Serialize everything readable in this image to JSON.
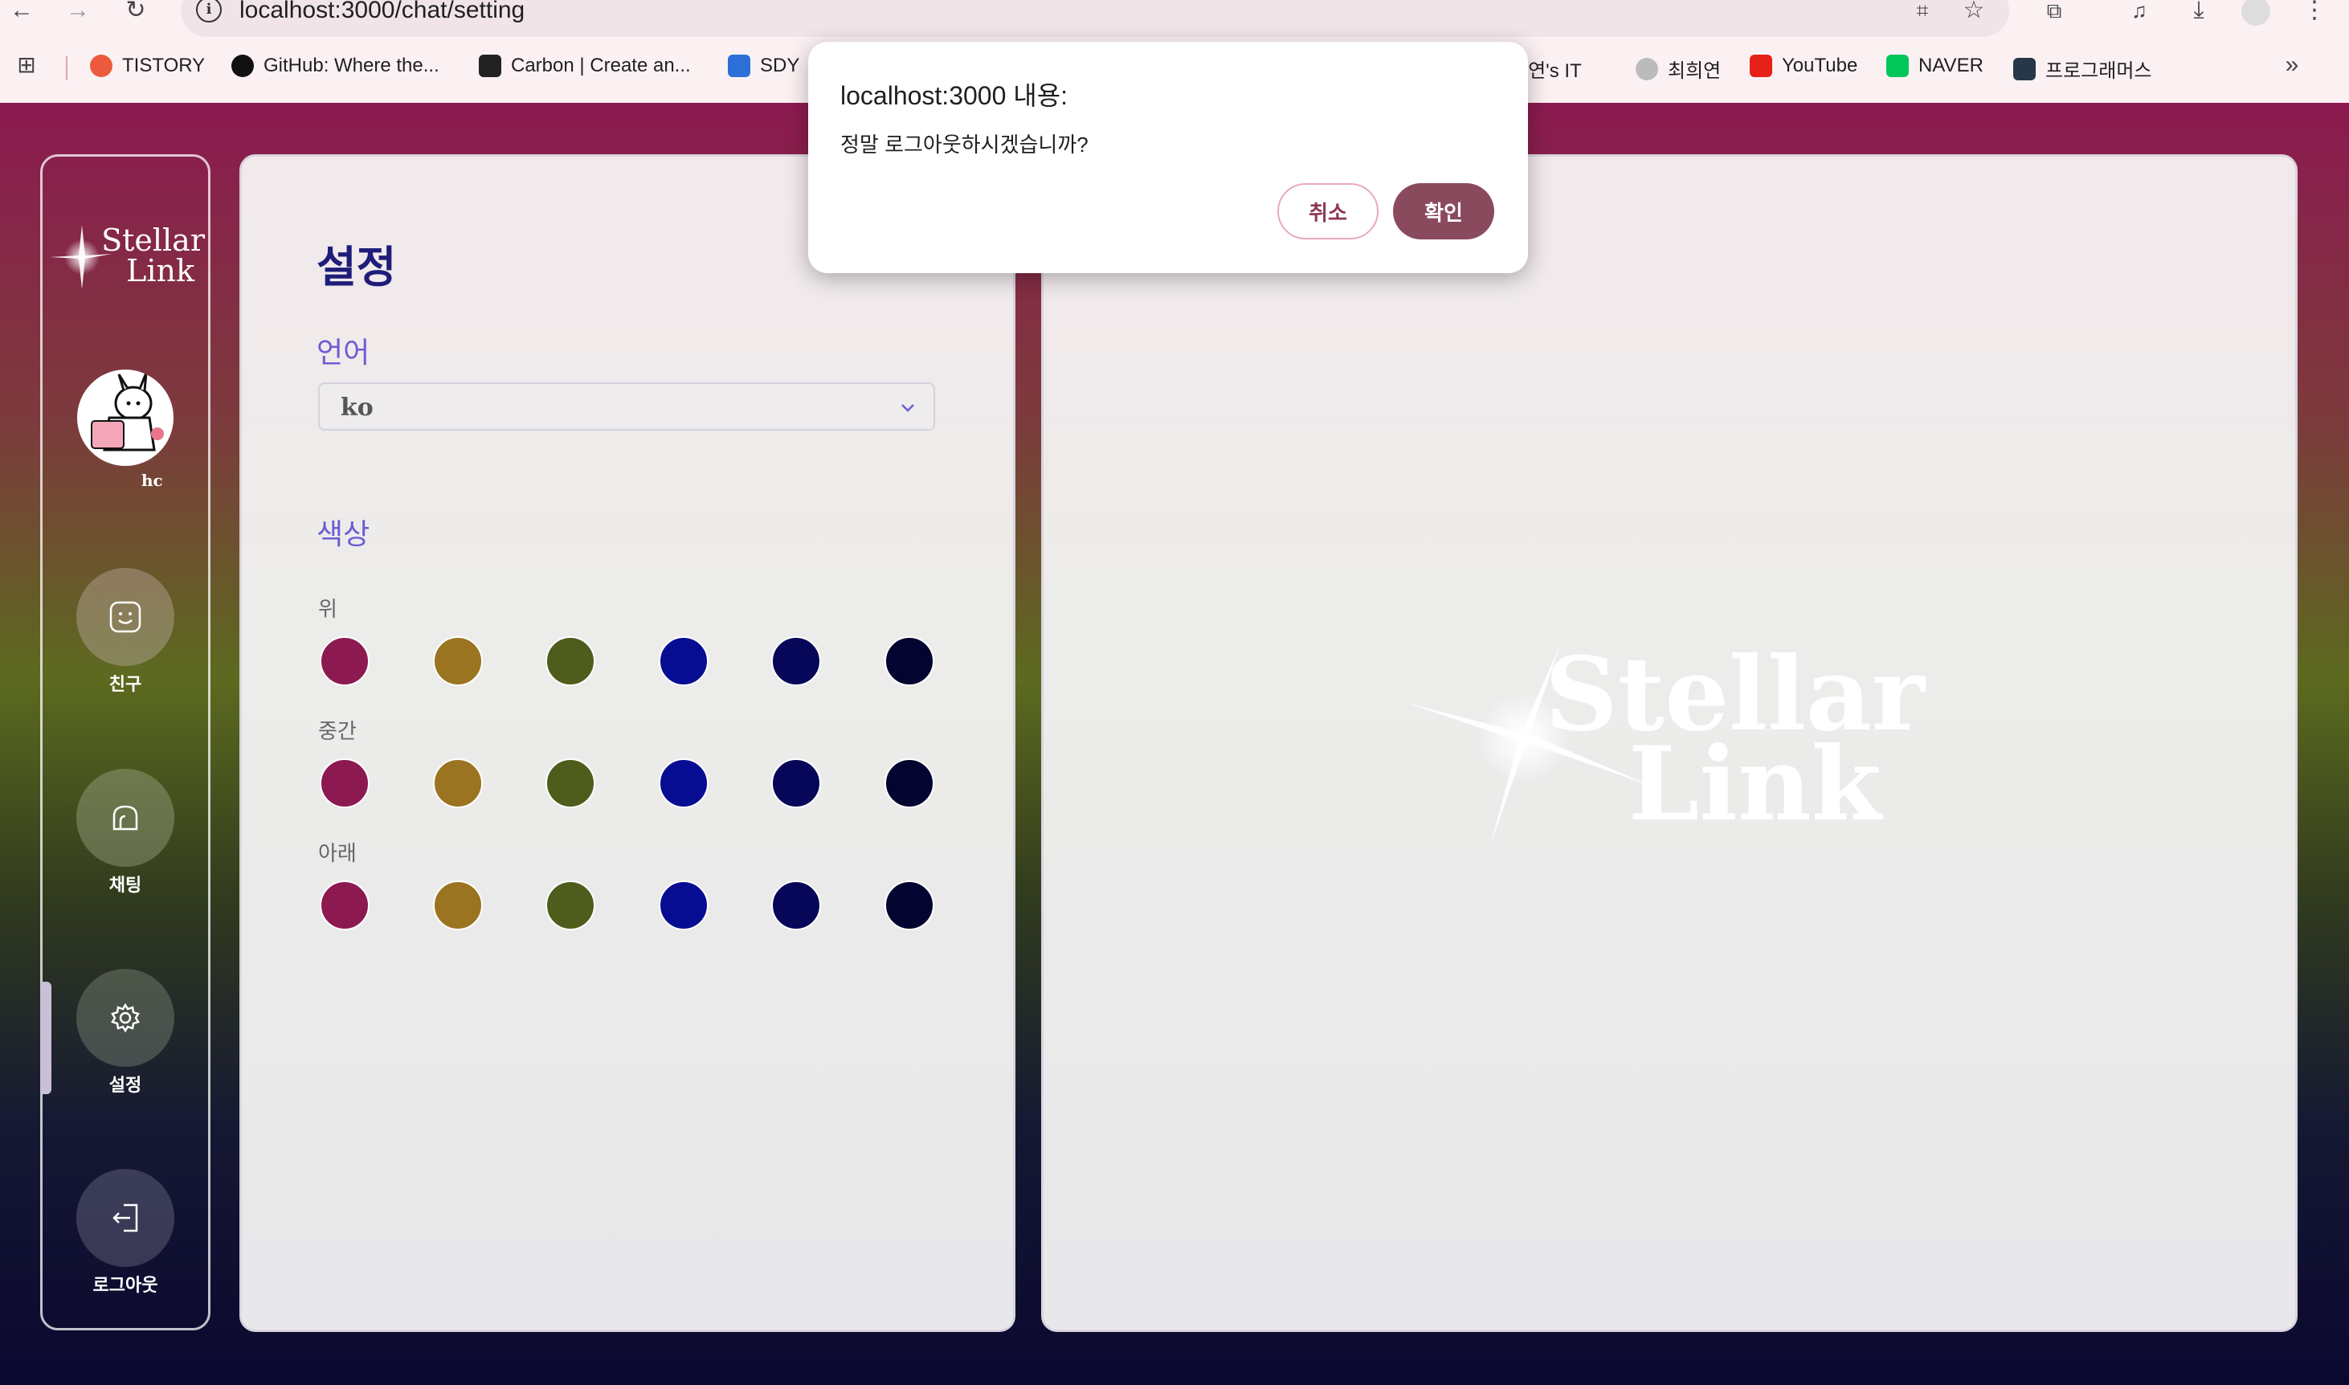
{
  "browser": {
    "url": "localhost:3000/chat/setting",
    "bookmarks": [
      {
        "label": "TISTORY",
        "icon": "tistory-icon",
        "color": "#eb5a3c"
      },
      {
        "label": "GitHub: Where the...",
        "icon": "github-icon",
        "color": "#111111"
      },
      {
        "label": "Carbon | Create an...",
        "icon": "carbon-icon",
        "color": "#222222"
      },
      {
        "label": "SDY",
        "icon": "jira-icon",
        "color": "#2c6fd6"
      },
      {
        "label": "희연's IT",
        "icon": "blog-icon",
        "color": "#888888"
      },
      {
        "label": "최희연",
        "icon": "profile-icon",
        "color": "#999999"
      },
      {
        "label": "YouTube",
        "icon": "youtube-icon",
        "color": "#e62117"
      },
      {
        "label": "NAVER",
        "icon": "naver-icon",
        "color": "#03c75a"
      },
      {
        "label": "프로그래머스",
        "icon": "programmers-icon",
        "color": "#263747"
      }
    ]
  },
  "sidebar": {
    "logo_line1": "Stellar",
    "logo_line2": "Link",
    "avatar_name": "hc",
    "items": [
      {
        "label": "친구",
        "icon": "smile-icon"
      },
      {
        "label": "채팅",
        "icon": "chat-icon"
      },
      {
        "label": "설정",
        "icon": "gear-icon"
      },
      {
        "label": "로그아웃",
        "icon": "logout-icon"
      }
    ]
  },
  "settings": {
    "title": "설정",
    "language_label": "언어",
    "language_value": "ko",
    "color_label": "색상",
    "rows": [
      {
        "label": "위"
      },
      {
        "label": "중간"
      },
      {
        "label": "아래"
      }
    ],
    "palette": [
      "#8c1a50",
      "#9a7420",
      "#4f5d1c",
      "#070d93",
      "#060758",
      "#040430"
    ]
  },
  "main_logo": {
    "line1": "Stellar",
    "line2": "Link"
  },
  "dialog": {
    "title": "localhost:3000 내용:",
    "message": "정말 로그아웃하시겠습니까?",
    "cancel_label": "취소",
    "ok_label": "확인"
  }
}
